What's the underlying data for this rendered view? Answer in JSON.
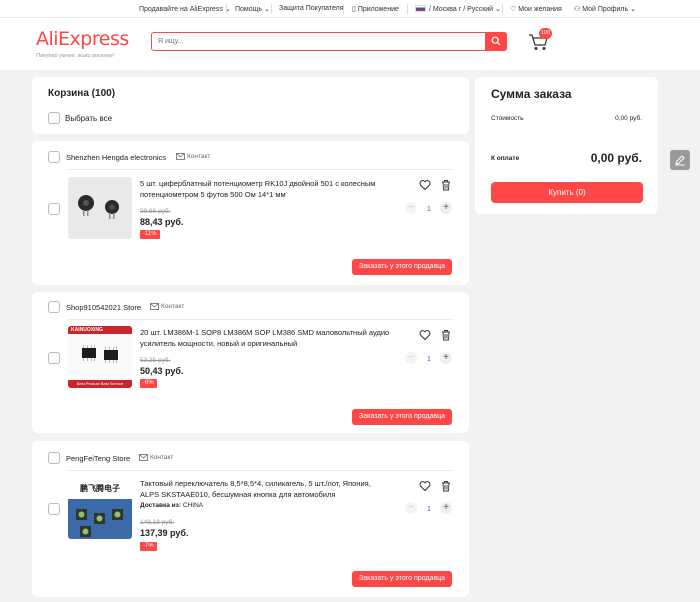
{
  "topbar": {
    "sell": "Продавайте на AliExpress",
    "help": "Помощь",
    "buyer_protection": "Защита Покупателя",
    "app": "Приложение",
    "region": "/ Москва г / Русский",
    "wishlist": "Мои желания",
    "profile": "Мой Профиль"
  },
  "header": {
    "logo": "AliExpress",
    "slogan": "Покупай умнее, живи веселее!",
    "search_placeholder": "Я ищу...",
    "cart_count": "100"
  },
  "cart": {
    "title": "Корзина (100)",
    "select_all": "Выбрать все"
  },
  "sellers": [
    {
      "name": "Shenzhen Hengda electronics",
      "contact": "Контакт",
      "product": {
        "title": "5 шт. циферблатный потенциометр RK10J двойной 501 с колесным потенциометром 5 футов 500 Ом 14*1 мм",
        "old_price": "99,66 руб.",
        "price": "88,43 руб.",
        "discount": "-11%",
        "qty": "1"
      },
      "button": "Заказать у этого продавца"
    },
    {
      "name": "Shop910542021 Store",
      "contact": "Контакт",
      "product": {
        "title": "20 шт. LM386M-1 SOP8 LM386M SOP LM386 SMD маловольтный аудио усилитель мощности, новый и оригинальный",
        "old_price": "53,35 руб.",
        "price": "50,43 руб.",
        "discount": "-6%",
        "qty": "1",
        "brand": "KAINUOXING",
        "tagline": "Best Product Best Service"
      },
      "button": "Заказать у этого продавца"
    },
    {
      "name": "PengFeiTeng Store",
      "contact": "Контакт",
      "product": {
        "title": "Тактовый переключатель 8,5*8,5*4, силикагель, 5 шт./лот, Япония, ALPS SKSTAAE010, бесшумная кнопка для автомобиля",
        "delivery_label": "Доставка из:",
        "delivery_value": "CHINA",
        "old_price": "148,18 руб.",
        "price": "137,39 руб.",
        "discount": "-7%",
        "qty": "1",
        "brand": "鹏飞腾电子"
      },
      "button": "Заказать у этого продавца"
    }
  ],
  "summary": {
    "title": "Сумма заказа",
    "cost_label": "Стоимость",
    "cost_value": "0,00 руб.",
    "total_label": "К оплате",
    "total_value": "0,00 руб.",
    "buy_button": "Купить (0)"
  },
  "colors": {
    "accent": "#ff4747",
    "qty_text": "#2a6ec7",
    "background": "#f2f2f2"
  }
}
